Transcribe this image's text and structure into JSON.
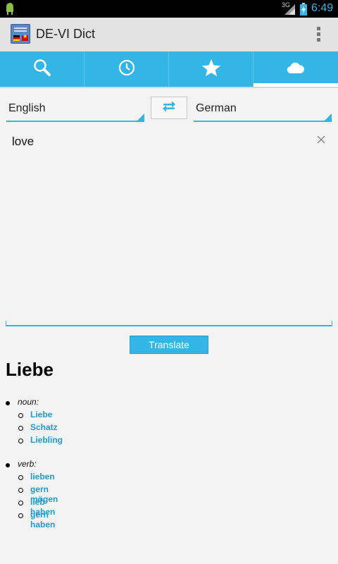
{
  "status_bar": {
    "network": "3G",
    "time": "6:49"
  },
  "app": {
    "title": "DE-VI Dict"
  },
  "tabs": [
    {
      "icon": "search-icon"
    },
    {
      "icon": "history-clock-icon"
    },
    {
      "icon": "favorites-star-icon"
    },
    {
      "icon": "cloud-icon",
      "selected": true
    }
  ],
  "translator": {
    "source_language": "English",
    "target_language": "German",
    "input_text": "love",
    "translate_label": "Translate"
  },
  "result": {
    "word": "Liebe",
    "groups": [
      {
        "pos": "noun:",
        "meanings": [
          "Liebe",
          "Schatz",
          "Liebling"
        ]
      },
      {
        "pos": "verb:",
        "meanings": [
          "lieben",
          "gern mögen",
          "lieb haben",
          "gern haben"
        ]
      }
    ]
  },
  "colors": {
    "accent": "#33b5e5",
    "link": "#1e9bd7",
    "actionbar": "#e3e3e3",
    "background": "#f3f3f3"
  }
}
